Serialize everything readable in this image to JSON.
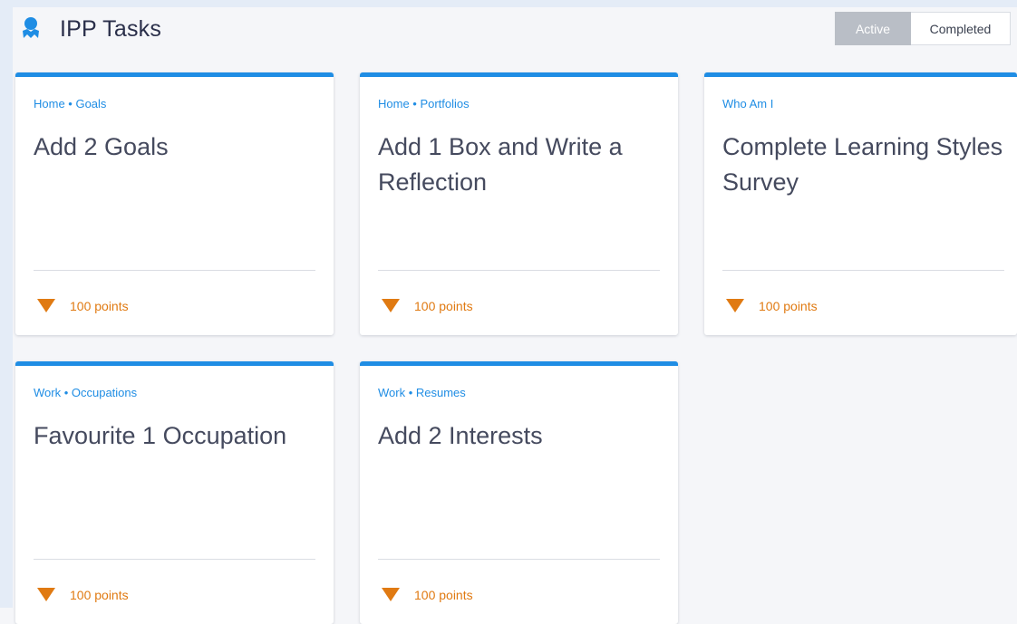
{
  "header": {
    "title": "IPP Tasks",
    "icon": "ribbon-badge-icon",
    "accent": "#1f8de4"
  },
  "toggle": {
    "active_label": "Active",
    "completed_label": "Completed",
    "selected": "Active"
  },
  "tasks": [
    {
      "breadcrumb": "Home • Goals",
      "title": "Add 2 Goals",
      "points": "100 points"
    },
    {
      "breadcrumb": "Home • Portfolios",
      "title": "Add 1 Box and Write a Reflection",
      "points": "100 points"
    },
    {
      "breadcrumb": "Who Am I",
      "title": "Complete Learning Styles Survey",
      "points": "100 points"
    },
    {
      "breadcrumb": "Work • Occupations",
      "title": "Favourite 1 Occupation",
      "points": "100 points"
    },
    {
      "breadcrumb": "Work • Resumes",
      "title": "Add 2 Interests",
      "points": "100 points"
    }
  ],
  "colors": {
    "card_top_border": "#1f8de4",
    "points": "#e07a12",
    "background": "#f5f6f9"
  }
}
